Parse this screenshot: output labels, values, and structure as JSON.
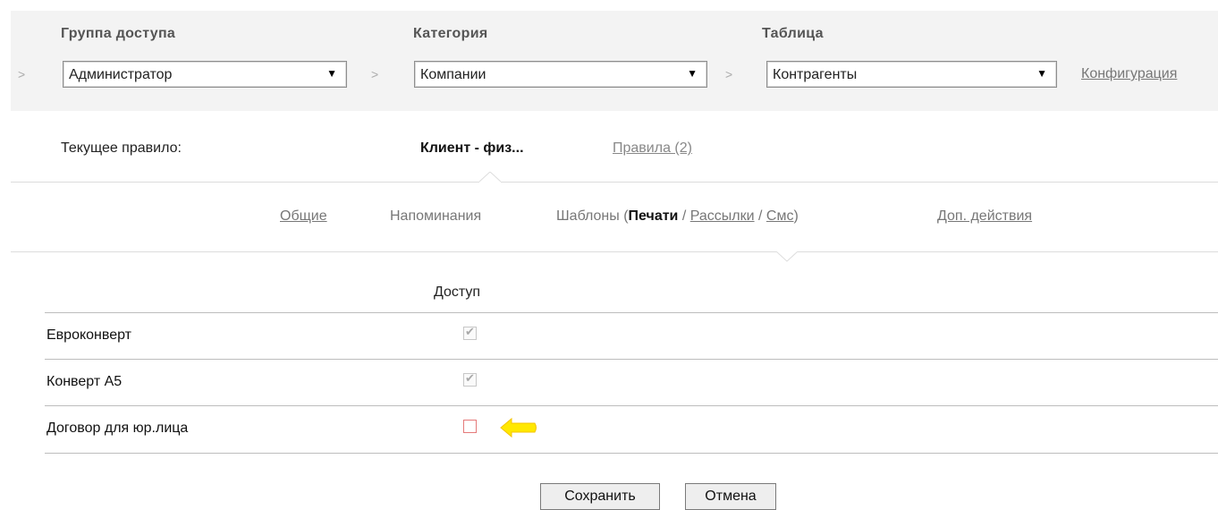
{
  "filters": {
    "group": {
      "label": "Группа доступа",
      "value": "Администратор"
    },
    "category": {
      "label": "Категория",
      "value": "Компании"
    },
    "table": {
      "label": "Таблица",
      "value": "Контрагенты"
    },
    "separator": ">",
    "caret": "▼",
    "config_link": "Конфигурация"
  },
  "rule": {
    "label": "Текущее правило:",
    "name": "Клиент - физ...",
    "rules_link": "Правила (2)"
  },
  "tabs": {
    "general": "Общие",
    "reminders": "Напоминания",
    "templates_prefix": "Шаблоны (",
    "print": "Печати",
    "slash": "/",
    "mailings": "Рассылки",
    "sms": "Смс",
    "close_paren": ")",
    "extra_actions": "Доп. действия"
  },
  "table": {
    "column_access": "Доступ",
    "rows": [
      {
        "name": "Евроконверт",
        "access": true
      },
      {
        "name": "Конверт А5",
        "access": true
      },
      {
        "name": "Договор для юр.лица",
        "access": false
      }
    ],
    "check_glyph": "✔"
  },
  "buttons": {
    "save": "Сохранить",
    "cancel": "Отмена"
  },
  "colors": {
    "highlight_arrow": "#ffe800",
    "unchecked_border": "#e57a7a"
  }
}
